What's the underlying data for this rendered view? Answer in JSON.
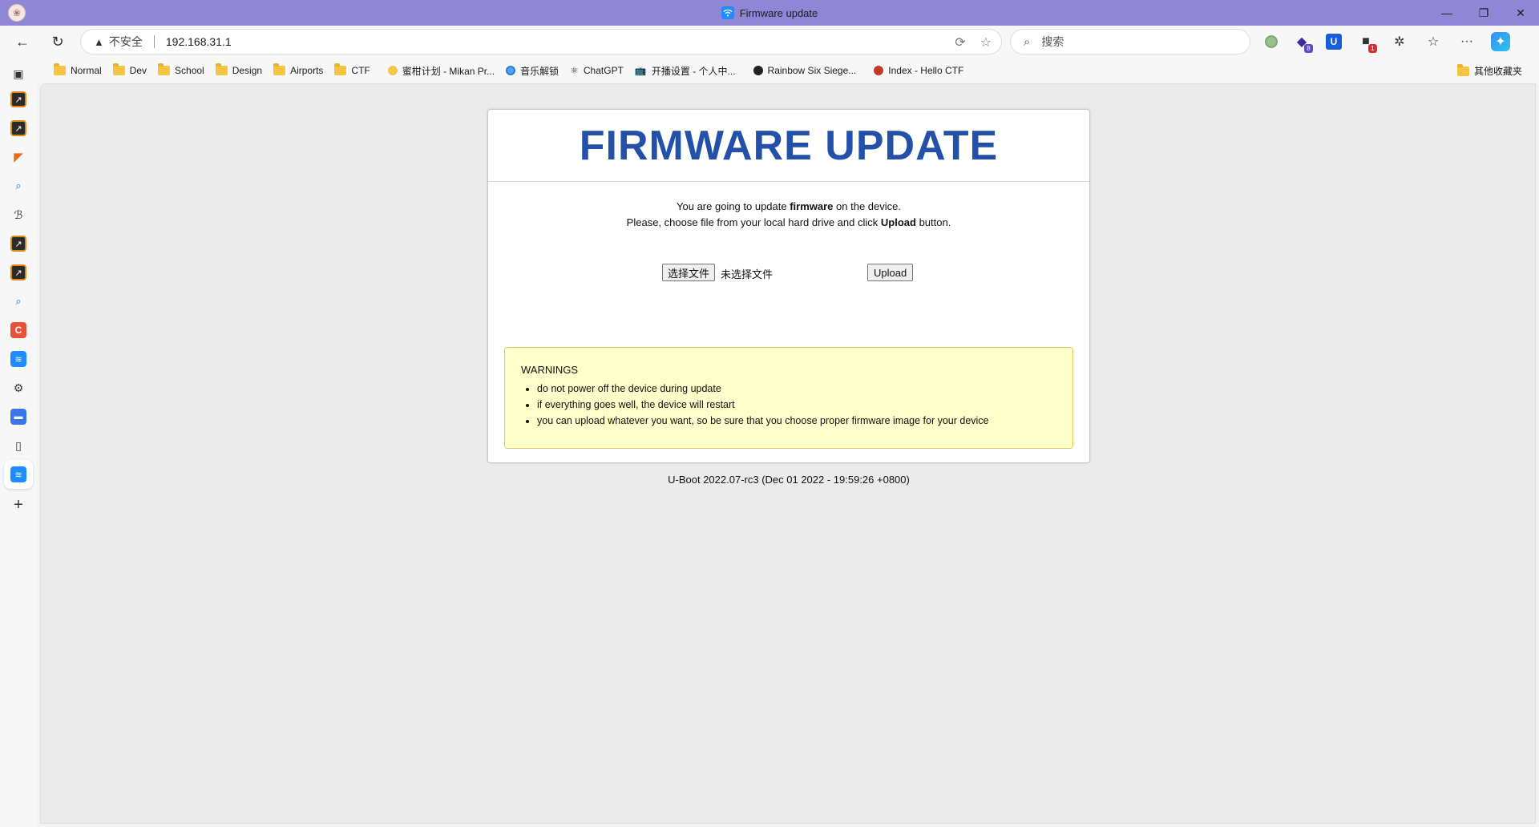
{
  "window": {
    "title": "Firmware update"
  },
  "toolbar": {
    "security_label": "不安全",
    "url": "192.168.31.1",
    "search_placeholder": "搜索"
  },
  "favorites": {
    "items": [
      {
        "label": "Normal",
        "type": "folder"
      },
      {
        "label": "Dev",
        "type": "folder"
      },
      {
        "label": "School",
        "type": "folder"
      },
      {
        "label": "Design",
        "type": "folder"
      },
      {
        "label": "Airports",
        "type": "folder"
      },
      {
        "label": "CTF",
        "type": "folder"
      },
      {
        "label": "蜜柑计划 - Mikan Pr...",
        "type": "link"
      },
      {
        "label": "音乐解锁",
        "type": "link"
      },
      {
        "label": "ChatGPT",
        "type": "link"
      },
      {
        "label": "开播设置 - 个人中...",
        "type": "link"
      },
      {
        "label": "Rainbow Six Siege...",
        "type": "link"
      },
      {
        "label": "Index - Hello CTF",
        "type": "link"
      }
    ],
    "other_folder": "其他收藏夹"
  },
  "page": {
    "heading": "FIRMWARE UPDATE",
    "line1_pre": "You are going to update ",
    "line1_bold": "firmware",
    "line1_post": " on the device.",
    "line2_pre": "Please, choose file from your local hard drive and click ",
    "line2_bold": "Upload",
    "line2_post": " button.",
    "choose_file_label": "选择文件",
    "no_file_label": "未选择文件",
    "upload_label": "Upload",
    "warnings_title": "WARNINGS",
    "warnings": [
      "do not power off the device during update",
      "if everything goes well, the device will restart",
      "you can upload whatever you want, so be sure that you choose proper firmware image for your device"
    ],
    "footer": "U-Boot 2022.07-rc3 (Dec 01 2022 - 19:59:26 +0800)"
  },
  "extensions": {
    "badge_1": "8",
    "badge_2": "1"
  },
  "colors": {
    "titlebar": "#8f86d6",
    "heading": "#2350a8",
    "warning_bg": "#ffffcc",
    "warning_border": "#e8c766"
  }
}
